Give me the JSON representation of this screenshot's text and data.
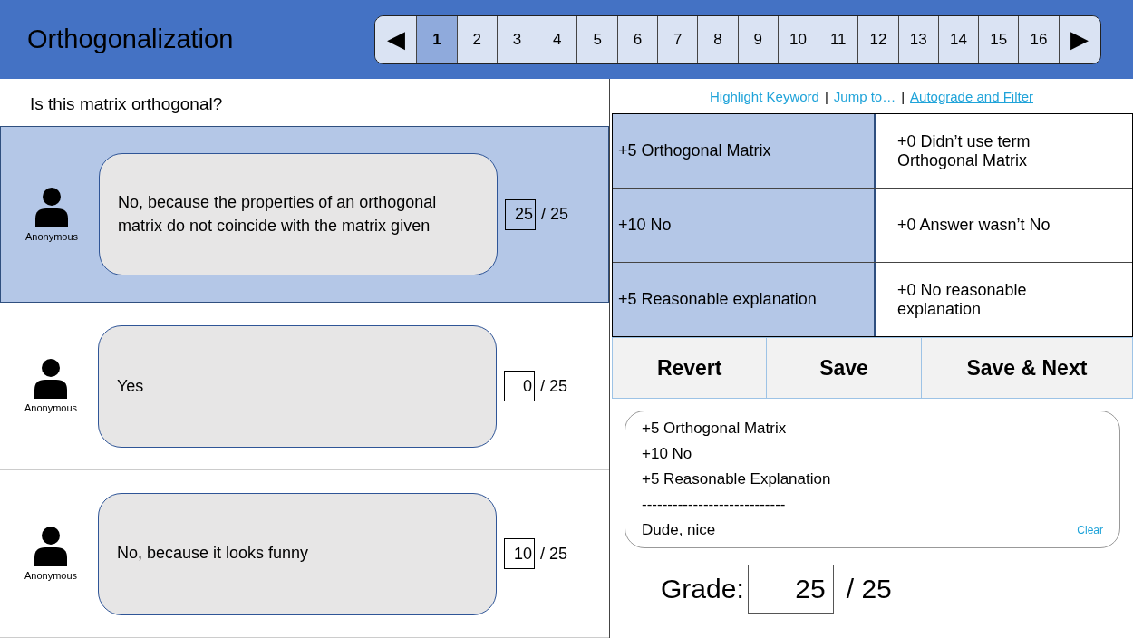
{
  "header": {
    "title": "Orthogonalization"
  },
  "pager": {
    "prev": "◀",
    "next": "▶",
    "pages": [
      {
        "label": "1",
        "selected": true
      },
      {
        "label": "2",
        "selected": false
      },
      {
        "label": "3",
        "selected": false
      },
      {
        "label": "4",
        "selected": false
      },
      {
        "label": "5",
        "selected": false
      },
      {
        "label": "6",
        "selected": false
      },
      {
        "label": "7",
        "selected": false
      },
      {
        "label": "8",
        "selected": false
      },
      {
        "label": "9",
        "selected": false
      },
      {
        "label": "10",
        "selected": false
      },
      {
        "label": "11",
        "selected": false
      },
      {
        "label": "12",
        "selected": false
      },
      {
        "label": "13",
        "selected": false
      },
      {
        "label": "14",
        "selected": false
      },
      {
        "label": "15",
        "selected": false
      },
      {
        "label": "16",
        "selected": false
      }
    ]
  },
  "question": "Is this matrix orthogonal?",
  "answers": [
    {
      "author": "Anonymous",
      "text": "No, because the properties of an orthogonal matrix do not coincide with the matrix given",
      "score": "25",
      "max": "/ 25",
      "selected": true
    },
    {
      "author": "Anonymous",
      "text": "Yes",
      "score": "0",
      "max": "/ 25",
      "selected": false
    },
    {
      "author": "Anonymous",
      "text": "No, because it looks funny",
      "score": "10",
      "max": "/ 25",
      "selected": false
    }
  ],
  "tools": [
    {
      "kind": "link",
      "label": "Highlight Keyword",
      "underlined": false
    },
    {
      "kind": "separator",
      "label": "|"
    },
    {
      "kind": "link",
      "label": "Jump to…",
      "underlined": false
    },
    {
      "kind": "separator",
      "label": "|"
    },
    {
      "kind": "link",
      "label": "Autograde and Filter",
      "underlined": true
    }
  ],
  "rubric": [
    {
      "earned": {
        "label": "+5 Orthogonal Matrix",
        "selected": true
      },
      "missed": {
        "label": "+0 Didn’t use term Orthogonal Matrix",
        "selected": false
      }
    },
    {
      "earned": {
        "label": "+10 No",
        "selected": true
      },
      "missed": {
        "label": "+0 Answer wasn’t No",
        "selected": false
      }
    },
    {
      "earned": {
        "label": "+5 Reasonable explanation",
        "selected": true
      },
      "missed": {
        "label": "+0 No reasonable explanation",
        "selected": false
      }
    }
  ],
  "buttons": [
    "Revert",
    "Save",
    "Save & Next"
  ],
  "comment": {
    "lines": [
      "+5 Orthogonal Matrix",
      "+10 No",
      "+5 Reasonable Explanation",
      "----------------------------",
      "Dude, nice"
    ],
    "clear": "Clear"
  },
  "grade": {
    "label": "Grade:",
    "value": "25",
    "max": "/ 25"
  }
}
